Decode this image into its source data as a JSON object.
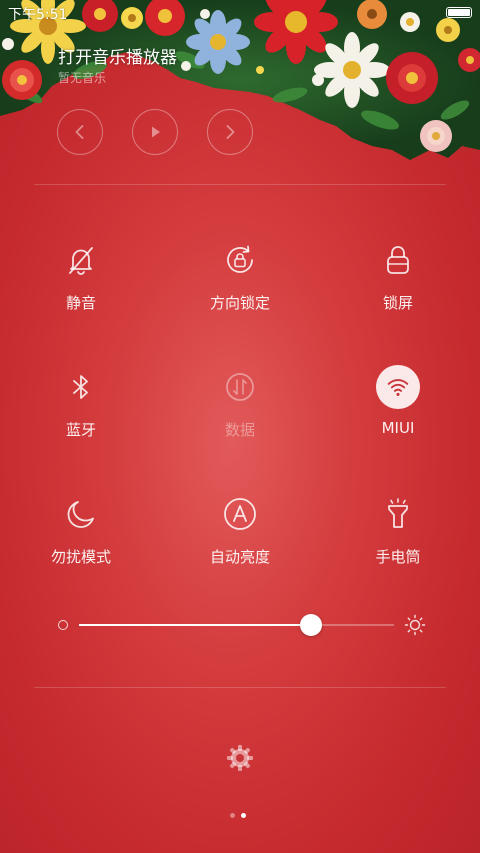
{
  "status_bar": {
    "time": "下午5:51"
  },
  "music": {
    "title": "打开音乐播放器",
    "subtitle": "暂无音乐",
    "controls": [
      "chevron-left-icon",
      "play-icon",
      "chevron-right-icon"
    ]
  },
  "toggles": [
    {
      "label": "静音",
      "icon": "mute-bell-icon",
      "state": "off"
    },
    {
      "label": "方向锁定",
      "icon": "rotation-lock-icon",
      "state": "off"
    },
    {
      "label": "锁屏",
      "icon": "lock-icon",
      "state": "off"
    },
    {
      "label": "蓝牙",
      "icon": "bluetooth-icon",
      "state": "off"
    },
    {
      "label": "数据",
      "icon": "mobile-data-icon",
      "state": "disabled"
    },
    {
      "label": "MIUI",
      "icon": "wifi-icon",
      "state": "on"
    },
    {
      "label": "勿扰模式",
      "icon": "moon-icon",
      "state": "off"
    },
    {
      "label": "自动亮度",
      "icon": "auto-brightness-icon",
      "state": "off"
    },
    {
      "label": "手电筒",
      "icon": "flashlight-icon",
      "state": "off"
    }
  ],
  "brightness": {
    "level": 0.735
  },
  "pager": {
    "count": 2,
    "active": 1
  },
  "colors": {
    "background": "#d43c3e",
    "active_toggle_bg": "#fbe9e9",
    "active_toggle_icon": "#c8353a"
  }
}
